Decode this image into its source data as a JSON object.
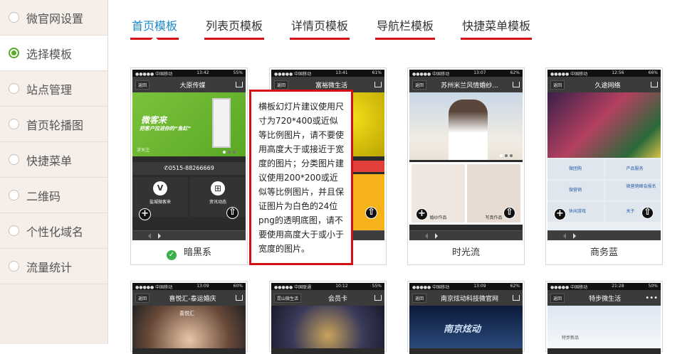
{
  "sidebar": {
    "items": [
      {
        "label": "微官网设置",
        "icon": "radio-icon"
      },
      {
        "label": "选择模板",
        "icon": "radio-icon",
        "active": true
      },
      {
        "label": "站点管理",
        "icon": "radio-icon"
      },
      {
        "label": "首页轮播图",
        "icon": "radio-icon"
      },
      {
        "label": "快捷菜单",
        "icon": "radio-icon"
      },
      {
        "label": "二维码",
        "icon": "radio-icon"
      },
      {
        "label": "个性化域名",
        "icon": "radio-icon"
      },
      {
        "label": "流量统计",
        "icon": "radio-icon"
      }
    ]
  },
  "tabs": [
    {
      "label": "首页模板",
      "active": true
    },
    {
      "label": "列表页模板"
    },
    {
      "label": "详情页模板"
    },
    {
      "label": "导航栏模板"
    },
    {
      "label": "快捷菜单模板"
    }
  ],
  "colors": {
    "accent": "#1d8ac9",
    "tab_underline": "#d40f15",
    "selected_check": "#3ab04b",
    "sidebar_bg": "#f4ece7"
  },
  "templates": [
    {
      "name": "暗黑系",
      "selected": true,
      "status_left": "●●●●● 中国移动",
      "time": "13:42",
      "battery": "55%",
      "title": "大原传媒",
      "back": "返回",
      "banner_text": "微客来",
      "banner_sub": "把客户拉进你的“鱼缸”",
      "banner_follow": "求关注",
      "phone": "0515-88266669",
      "tile1": "盐城微客来",
      "tile2": "资讯动态"
    },
    {
      "name": "",
      "status_left": "●●●●● 中国移动",
      "time": "13:41",
      "battery": "61%",
      "title": "富裕微生活",
      "back": "返回"
    },
    {
      "name": "时光流",
      "status_left": "●●●●● 中国移动",
      "time": "13:07",
      "battery": "62%",
      "title": "苏州米兰风情婚纱...",
      "back": "返回",
      "tile1": "婚纱作品",
      "tile2": "写真作品"
    },
    {
      "name": "商务蓝",
      "status_left": "●●●●● 中国移动",
      "time": "12:56",
      "battery": "66%",
      "title": "久途网络",
      "back": "返回",
      "tile1": "微团购",
      "tile2": "产品服务",
      "tile3": "微营销",
      "tile4": "微营销峰会报名",
      "tile5": "休闲游戏",
      "tile6": "关于"
    },
    {
      "name": "",
      "status_left": "●●●●● 中国移动",
      "time": "13:09",
      "battery": "60%",
      "title": "喜悦汇-泰运婚庆",
      "back": "返回",
      "banner_text": "喜悦汇"
    },
    {
      "name": "",
      "status_left": "●●●●● 中国联通",
      "time": "10:12",
      "battery": "55%",
      "title": "会员卡",
      "back": "昆山微生活"
    },
    {
      "name": "",
      "status_left": "●●●●● 中国移动",
      "time": "13:09",
      "battery": "62%",
      "title": "南京炫动科技微官网",
      "back": "返回",
      "banner_text": "南京炫动"
    },
    {
      "name": "",
      "status_left": "●●●●● 中国移动",
      "time": "21:28",
      "battery": "50%",
      "title": "特步微生活",
      "back": "返回",
      "banner_text": "特步新品"
    }
  ],
  "tooltip": {
    "text": "横板幻灯片建议使用尺寸为720*400或近似等比例图片，请不要使用高度大于或接近于宽度的图片；分类图片建议使用200*200或近似等比例图片，并且保证图片为白色的24位png的透明底图，请不要使用高度大于或小于宽度的图片。"
  }
}
